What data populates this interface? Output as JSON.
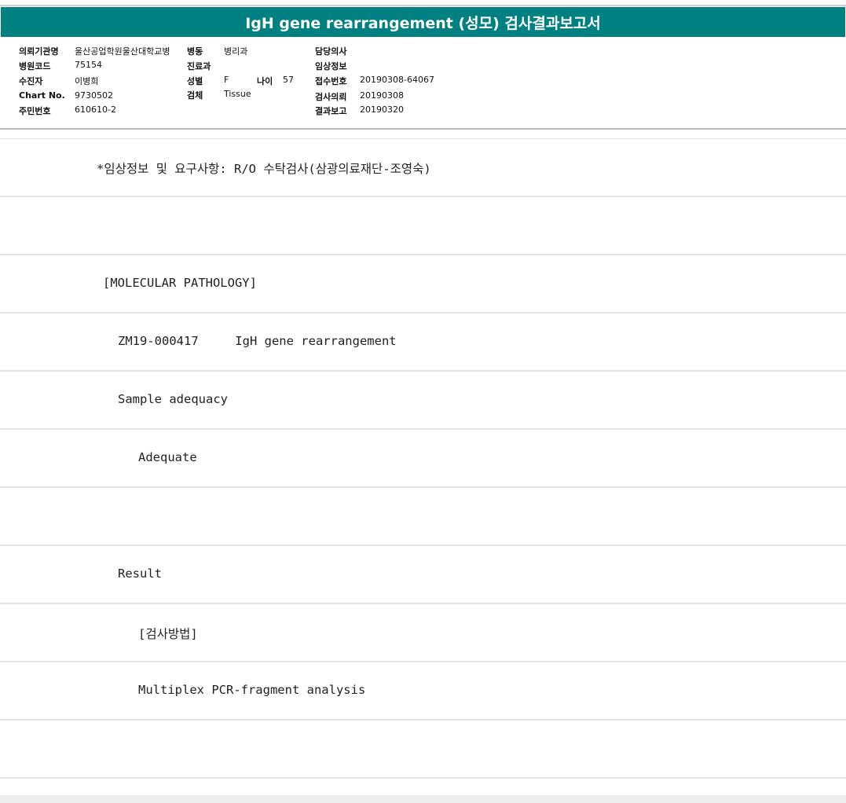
{
  "title": "IgH gene rearrangement (성모) 검사결과보고서",
  "patient_info": {
    "institution_label": "의뢰기관명",
    "institution_value": "울산공업학원울산대학교병",
    "ward_label": "병동",
    "ward_value": "병리과",
    "physician_label": "담당의사",
    "physician_value": "",
    "hospital_code_label": "병원코드",
    "hospital_code_value": "75154",
    "department_label": "진료과",
    "department_value": "",
    "clinical_info_label": "임상정보",
    "clinical_info_value": "",
    "recipient_label": "수진자",
    "recipient_value": "이병희",
    "sex_label": "성별",
    "sex_value": "F",
    "age_label": "나이",
    "age_value": "57",
    "accession_label": "접수번호",
    "accession_value": "20190308-64067",
    "chart_label": "Chart No.",
    "chart_value": "9730502",
    "specimen_label": "검체",
    "specimen_value": "Tissue",
    "request_date_label": "검사의뢰",
    "request_date_value": "20190308",
    "id_label": "주민번호",
    "id_value": "610610-2",
    "report_date_label": "결과보고",
    "report_date_value": "20190320"
  },
  "report_lines": [
    "*임상정보 및 요구사항: R/O 수탁검사(삼광의료재단-조영숙)",
    "",
    "[MOLECULAR PATHOLOGY]",
    "ZM19-000417     IgH gene rearrangement",
    "Sample adequacy",
    "Adequate",
    "",
    "Result",
    "[검사방법]",
    "Multiplex PCR-fragment analysis",
    ""
  ]
}
